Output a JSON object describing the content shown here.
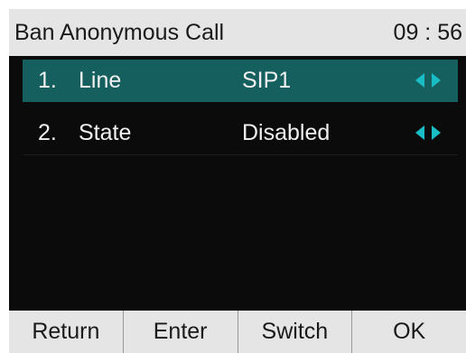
{
  "title_bar": {
    "title": "Ban Anonymous Call",
    "time": "09 : 56"
  },
  "menu": {
    "items": [
      {
        "index": "1.",
        "label": "Line",
        "value": "SIP1",
        "selected": true,
        "control_icon": "left-right-arrows-icon"
      },
      {
        "index": "2.",
        "label": "State",
        "value": "Disabled",
        "selected": false,
        "control_icon": "left-right-arrows-icon"
      }
    ]
  },
  "softkeys": [
    "Return",
    "Enter",
    "Switch",
    "OK"
  ],
  "colors": {
    "title_bar_bg": "#e5e5e5",
    "screen_bg": "#0b0b0b",
    "selected_row_bg": "#155f5e",
    "arrow_accent": "#1abdc6",
    "softkey_bg": "#e5e5e5"
  }
}
